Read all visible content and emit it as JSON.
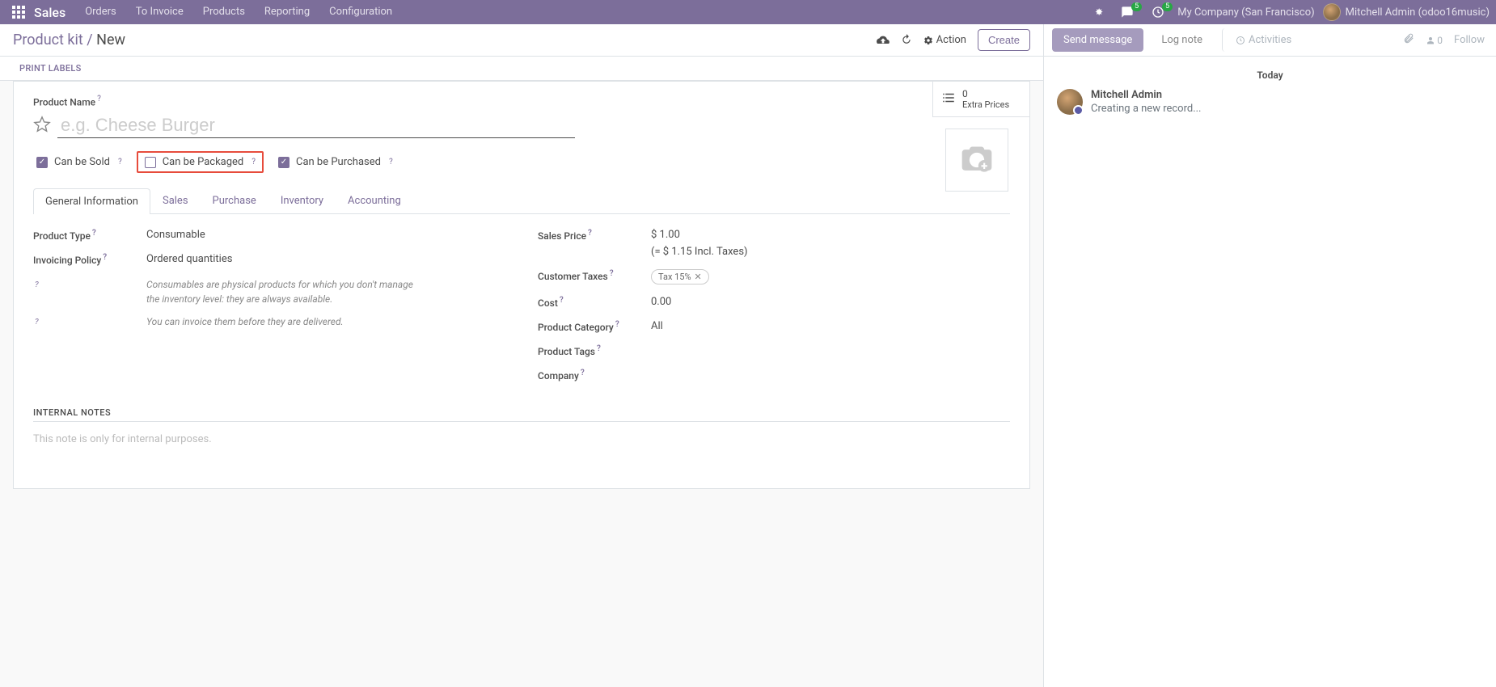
{
  "navbar": {
    "brand": "Sales",
    "menu": [
      "Orders",
      "To Invoice",
      "Products",
      "Reporting",
      "Configuration"
    ],
    "msg_badge": "5",
    "activity_badge": "5",
    "company": "My Company (San Francisco)",
    "user": "Mitchell Admin (odoo16music)"
  },
  "breadcrumb": {
    "parent": "Product kit",
    "sep": " / ",
    "current": "New"
  },
  "actions": {
    "action_label": "Action",
    "create_label": "Create"
  },
  "buttons": {
    "print_labels": "PRINT LABELS"
  },
  "stat": {
    "value": "0",
    "label": "Extra Prices"
  },
  "form": {
    "product_name_label": "Product Name",
    "product_name_placeholder": "e.g. Cheese Burger",
    "can_be_sold": "Can be Sold",
    "can_be_packaged": "Can be Packaged",
    "can_be_purchased": "Can be Purchased"
  },
  "tabs": [
    "General Information",
    "Sales",
    "Purchase",
    "Inventory",
    "Accounting"
  ],
  "general": {
    "product_type_label": "Product Type",
    "product_type_value": "Consumable",
    "invoicing_policy_label": "Invoicing Policy",
    "invoicing_policy_value": "Ordered quantities",
    "help1": "Consumables are physical products for which you don't manage the inventory level: they are always available.",
    "help2": "You can invoice them before they are delivered.",
    "sales_price_label": "Sales Price",
    "sales_price_value": "$ 1.00",
    "sales_price_incl": "(= $ 1.15 Incl. Taxes)",
    "customer_taxes_label": "Customer Taxes",
    "customer_taxes_value": "Tax 15%",
    "cost_label": "Cost",
    "cost_value": "0.00",
    "product_category_label": "Product Category",
    "product_category_value": "All",
    "product_tags_label": "Product Tags",
    "company_label": "Company"
  },
  "notes": {
    "title": "INTERNAL NOTES",
    "placeholder": "This note is only for internal purposes."
  },
  "chatter": {
    "send": "Send message",
    "log": "Log note",
    "activities": "Activities",
    "follower_count": "0",
    "follow": "Follow",
    "date": "Today",
    "author": "Mitchell Admin",
    "text": "Creating a new record..."
  }
}
